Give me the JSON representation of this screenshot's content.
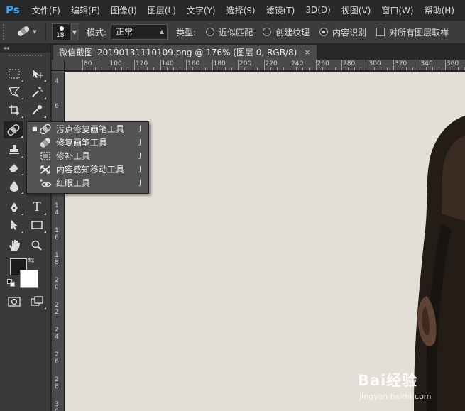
{
  "app": {
    "logo": "Ps",
    "menu": [
      "文件(F)",
      "编辑(E)",
      "图像(I)",
      "图层(L)",
      "文字(Y)",
      "选择(S)",
      "滤镜(T)",
      "3D(D)",
      "视图(V)",
      "窗口(W)",
      "帮助(H)"
    ]
  },
  "options": {
    "brush_size": "18",
    "mode_label": "模式:",
    "mode_value": "正常",
    "type_label": "类型:",
    "types": [
      "近似匹配",
      "创建纹理",
      "内容识别"
    ],
    "selected_type": "内容识别",
    "sample_all_layers": "对所有图层取样",
    "sample_all_layers_checked": false
  },
  "toolbar": {
    "collapse": "◂◂",
    "foreground_color": "#1c1c1c",
    "background_color": "#ffffff",
    "tools": [
      "rectangular-marquee-icon",
      "move-icon",
      "lasso-icon",
      "magic-wand-icon",
      "crop-icon",
      "eyedropper-icon",
      "spot-healing-icon",
      "brush-icon",
      "clone-stamp-icon",
      "history-brush-icon",
      "eraser-icon",
      "gradient-icon",
      "blur-icon",
      "dodge-icon",
      "pen-icon",
      "type-icon",
      "path-selection-icon",
      "rectangle-icon",
      "hand-icon",
      "zoom-icon",
      "quick-mask-icon",
      "screen-mode-icon"
    ]
  },
  "document": {
    "tab_title": "微信截图_20190131110109.png @ 176% (图层 0, RGB/8)",
    "close": "×",
    "canvas_color": "#e3ded6"
  },
  "rulers": {
    "top": [
      "80",
      "100",
      "120",
      "140",
      "160",
      "180",
      "200",
      "220",
      "240",
      "260",
      "280",
      "300",
      "320",
      "340",
      "360"
    ],
    "left": [
      "4",
      "6",
      "8",
      "1\n0",
      "1\n2",
      "1\n4",
      "1\n6",
      "1\n8",
      "2\n0",
      "2\n2",
      "2\n4",
      "2\n6",
      "2\n8",
      "3\n0"
    ]
  },
  "flyout": {
    "items": [
      {
        "label": "污点修复画笔工具",
        "key": "J",
        "icon": "spot-healing-icon",
        "selected": true
      },
      {
        "label": "修复画笔工具",
        "key": "J",
        "icon": "healing-brush-icon",
        "selected": false
      },
      {
        "label": "修补工具",
        "key": "J",
        "icon": "patch-icon",
        "selected": false
      },
      {
        "label": "内容感知移动工具",
        "key": "J",
        "icon": "content-aware-move-icon",
        "selected": false
      },
      {
        "label": "红眼工具",
        "key": "J",
        "icon": "red-eye-icon",
        "selected": false
      }
    ]
  },
  "watermark": {
    "brand": "Bai经验",
    "url": "jingyan.baidu.com"
  }
}
